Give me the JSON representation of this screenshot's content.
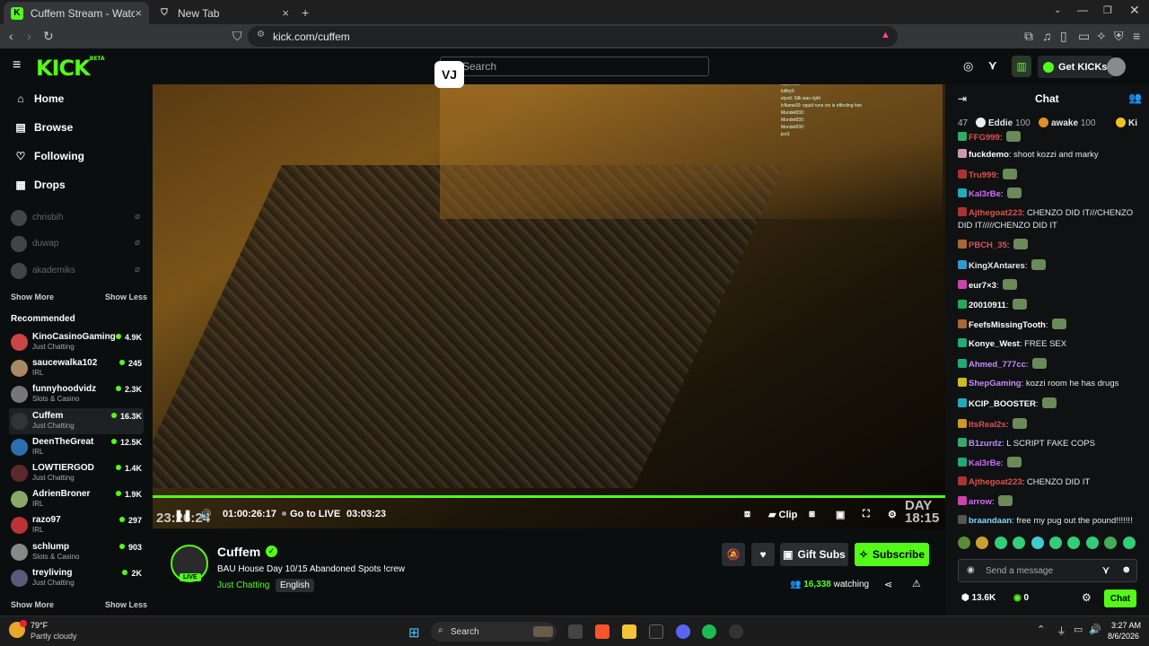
{
  "browser": {
    "tabs": [
      {
        "title": "Cuffem Stream - Watch Live o",
        "active": true
      },
      {
        "title": "New Tab",
        "active": false
      }
    ],
    "url": "kick.com/cuffem"
  },
  "header": {
    "logo": "KICK",
    "logo_sup": "BETA",
    "search_placeholder": "Search",
    "get_kicks_label": "Get KICKs",
    "overlay_badge": "VJ"
  },
  "sidebar": {
    "nav": [
      {
        "label": "Home",
        "icon": "home-icon"
      },
      {
        "label": "Browse",
        "icon": "browse-icon"
      },
      {
        "label": "Following",
        "icon": "heart-icon"
      },
      {
        "label": "Drops",
        "icon": "drops-icon"
      }
    ],
    "offline": [
      {
        "name": "chrisbih"
      },
      {
        "name": "duwap"
      },
      {
        "name": "akademiks"
      }
    ],
    "show_more": "Show More",
    "show_less": "Show Less",
    "recommended_title": "Recommended",
    "recommended": [
      {
        "name": "KinoCasinoGaming",
        "category": "Just Chatting",
        "viewers": "4.9K"
      },
      {
        "name": "saucewalka102",
        "category": "IRL",
        "viewers": "245"
      },
      {
        "name": "funnyhoodvidz",
        "category": "Slots & Casino",
        "viewers": "2.3K"
      },
      {
        "name": "Cuffem",
        "category": "Just Chatting",
        "viewers": "16.3K"
      },
      {
        "name": "DeenTheGreat",
        "category": "IRL",
        "viewers": "12.5K"
      },
      {
        "name": "LOWTIERGOD",
        "category": "Just Chatting",
        "viewers": "1.4K"
      },
      {
        "name": "AdrienBroner",
        "category": "IRL",
        "viewers": "1.9K"
      },
      {
        "name": "razo97",
        "category": "IRL",
        "viewers": "297"
      },
      {
        "name": "schlump",
        "category": "Slots & Casino",
        "viewers": "903"
      },
      {
        "name": "treyliving",
        "category": "Just Chatting",
        "viewers": "2K"
      }
    ]
  },
  "video": {
    "current_time": "01:00:26:17",
    "go_live": "Go to LIVE",
    "duration": "03:03:23",
    "clip_label": "Clip",
    "watermark_left": "23:26:24",
    "watermark_day": "DAY",
    "watermark_right": "18:15",
    "overlay_chat": [
      "Jayonot0: ",
      "lolthy0: ",
      "styxd: Silk was right",
      "lcflame00: squid runs cte is effecting him",
      "Mundel830: ",
      "Mundel830: ",
      "Mundel830: ",
      "jev3: "
    ]
  },
  "stream": {
    "streamer": "Cuffem",
    "live_badge": "LIVE",
    "title": "BAU House Day 10/15 Abandoned Spots !crew",
    "category": "Just Chatting",
    "language": "English",
    "watching_count": "16,338",
    "watching_label": "watching",
    "gift_subs": "Gift Subs",
    "subscribe": "Subscribe"
  },
  "chat": {
    "title": "Chat",
    "leaderboard": [
      {
        "rank": "47",
        "name": "Eddie",
        "score": "100"
      },
      {
        "rank": "",
        "name": "awake",
        "score": "100"
      },
      {
        "rank": "",
        "name": "Ki",
        "score": ""
      }
    ],
    "messages": [
      {
        "user": "FFG999",
        "color": "#e05050",
        "text": ""
      },
      {
        "user": "fuckdemo",
        "color": "#ffffff",
        "text": "shoot kozzi and marky"
      },
      {
        "user": "Tru999",
        "color": "#e05050",
        "text": ""
      },
      {
        "user": "Kal3rBe",
        "color": "#d16bff",
        "text": ""
      },
      {
        "user": "Ajthegoat223",
        "color": "#e05050",
        "text": "CHENZO DID IT///CHENZO DID IT/////CHENZO DID IT"
      },
      {
        "user": "PBCH_35",
        "color": "#e05050",
        "text": ""
      },
      {
        "user": "KingXAntares",
        "color": "#e8e8e8",
        "text": ""
      },
      {
        "user": "eur7×3",
        "color": "#ffffff",
        "text": ""
      },
      {
        "user": "20010911",
        "color": "#ffffff",
        "text": ""
      },
      {
        "user": "FeefsMissingTooth",
        "color": "#ffffff",
        "text": ""
      },
      {
        "user": "Konye_West",
        "color": "#ffffff",
        "text": "FREE SEX"
      },
      {
        "user": "Ahmed_777cc",
        "color": "#c58cff",
        "text": ""
      },
      {
        "user": "ShepGaming",
        "color": "#c58cff",
        "text": "kozzi room he has drugs"
      },
      {
        "user": "KCIP_BOOSTER",
        "color": "#ffffff",
        "text": ""
      },
      {
        "user": "ItsReal2s",
        "color": "#e05050",
        "text": ""
      },
      {
        "user": "B1zurdz",
        "color": "#c58cff",
        "text": "L SCRIPT FAKE COPS"
      },
      {
        "user": "Kal3rBe",
        "color": "#d16bff",
        "text": ""
      },
      {
        "user": "Ajthegoat223",
        "color": "#e05050",
        "text": "CHENZO DID IT"
      },
      {
        "user": "arrow",
        "color": "#d16bff",
        "text": ""
      },
      {
        "user": "braandaan",
        "color": "#7fd7ff",
        "text": "free my pug out the pound!!!!!!!"
      }
    ],
    "input_placeholder": "Send a message",
    "kicks_count": "13.6K",
    "points": "0",
    "send_label": "Chat"
  },
  "taskbar": {
    "weather_temp": "79°F",
    "weather_desc": "Partly cloudy",
    "search_label": "Search",
    "time": "3:27 AM",
    "date": "8/6/2026"
  },
  "colors": {
    "accent": "#53fc18",
    "bg": "#0b0e0f"
  }
}
